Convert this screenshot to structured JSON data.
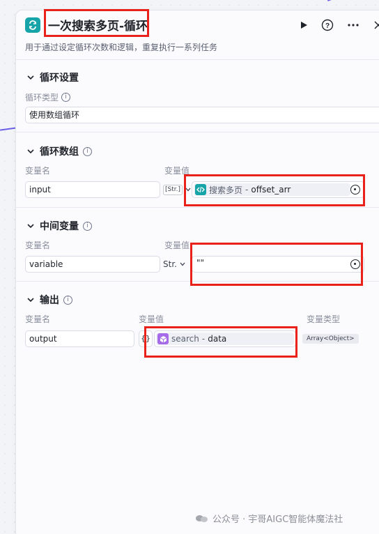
{
  "node": {
    "title": "一次搜索多页-循环",
    "subtitle": "用于通过设定循环次数和逻辑，重复执行一系列任务"
  },
  "loop_settings": {
    "section_title": "循环设置",
    "type_label": "循环类型",
    "type_value": "使用数组循环"
  },
  "loop_array": {
    "section_title": "循环数组",
    "name_header": "变量名",
    "value_header": "变量值",
    "row": {
      "name": "input",
      "type": "[Str.]",
      "source": "搜索多页",
      "separator": " - ",
      "variable": "offset_arr"
    }
  },
  "intermediate": {
    "section_title": "中间变量",
    "name_header": "变量名",
    "value_header": "变量值",
    "row": {
      "name": "variable",
      "type": "Str.",
      "value": "\"\""
    }
  },
  "output": {
    "section_title": "输出",
    "name_header": "变量名",
    "value_header": "变量值",
    "type_header": "变量类型",
    "row": {
      "name": "output",
      "type_icon": "{}",
      "source": "search",
      "separator": " - ",
      "variable": "data",
      "var_type": "Array<Object>"
    }
  },
  "watermark": "公众号 · 宇哥AIGC智能体魔法社",
  "colors": {
    "accent": "#4d53e8",
    "node_icon": "#16a4a8",
    "highlight": "#e8211b",
    "plugin_icon": "#a56be8"
  },
  "icons": [
    "loop-icon",
    "play-icon",
    "help-icon",
    "more-icon",
    "close-icon",
    "chevron-down-icon",
    "info-icon",
    "code-icon",
    "cube-icon",
    "variable-picker-icon",
    "plus-icon",
    "wechat-icon"
  ]
}
